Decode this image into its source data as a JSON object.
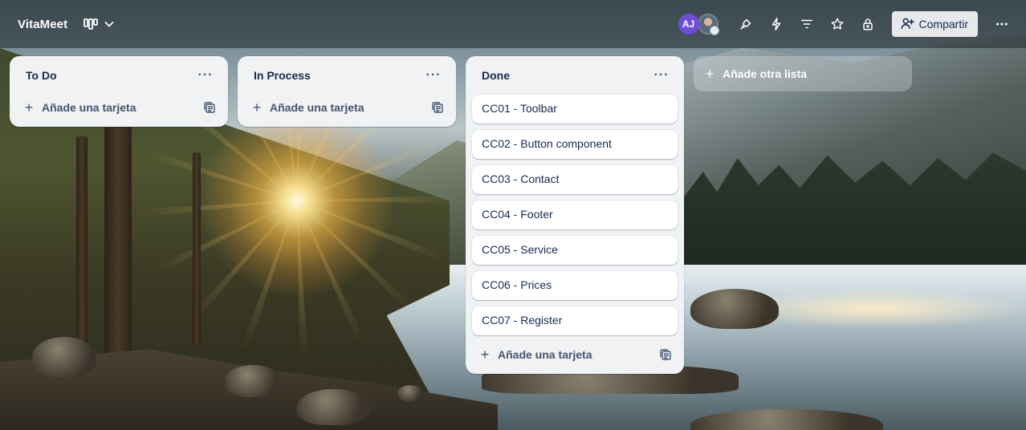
{
  "header": {
    "board_title": "VitaMeet",
    "avatar_initials": "AJ",
    "share_label": "Compartir",
    "icons": [
      "board-view-icon",
      "chevron-down-icon",
      "power-ups-icon",
      "automation-icon",
      "filter-icon",
      "star-icon",
      "lock-icon",
      "add-person-icon",
      "more-icon"
    ]
  },
  "lists": [
    {
      "title": "To Do",
      "cards": [],
      "add_card_label": "Añade una tarjeta"
    },
    {
      "title": "In Process",
      "cards": [],
      "add_card_label": "Añade una tarjeta"
    },
    {
      "title": "Done",
      "cards": [
        "CC01 - Toolbar",
        "CC02 - Button component",
        "CC03 - Contact",
        "CC04 - Footer",
        "CC05 - Service",
        "CC06 - Prices",
        "CC07 - Register"
      ],
      "add_card_label": "Añade una tarjeta"
    }
  ],
  "add_list_label": "Añade otra lista",
  "list_menu_glyph": "···",
  "colors": {
    "avatar_bg": "#6e4fd8",
    "list_bg": "#f1f2f4",
    "text": "#172b4d",
    "share_bg": "#e6e8ec"
  }
}
